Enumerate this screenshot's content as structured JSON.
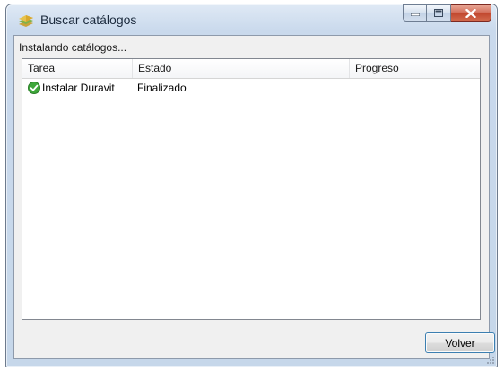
{
  "window": {
    "title": "Buscar catálogos",
    "controls": {
      "minimize": "minimize-icon",
      "maximize": "maximize-icon",
      "close": "close-icon"
    }
  },
  "status_text": "Instalando catálogos...",
  "list": {
    "columns": [
      "Tarea",
      "Estado",
      "Progreso"
    ],
    "rows": [
      {
        "icon": "check-success-icon",
        "task": "Instalar Duravit",
        "state": "Finalizado",
        "progress": ""
      }
    ]
  },
  "buttons": {
    "back_label": "Volver"
  },
  "colors": {
    "success": "#3ea73a",
    "close_button": "#c8462e",
    "focus_border": "#3c7fb1"
  }
}
